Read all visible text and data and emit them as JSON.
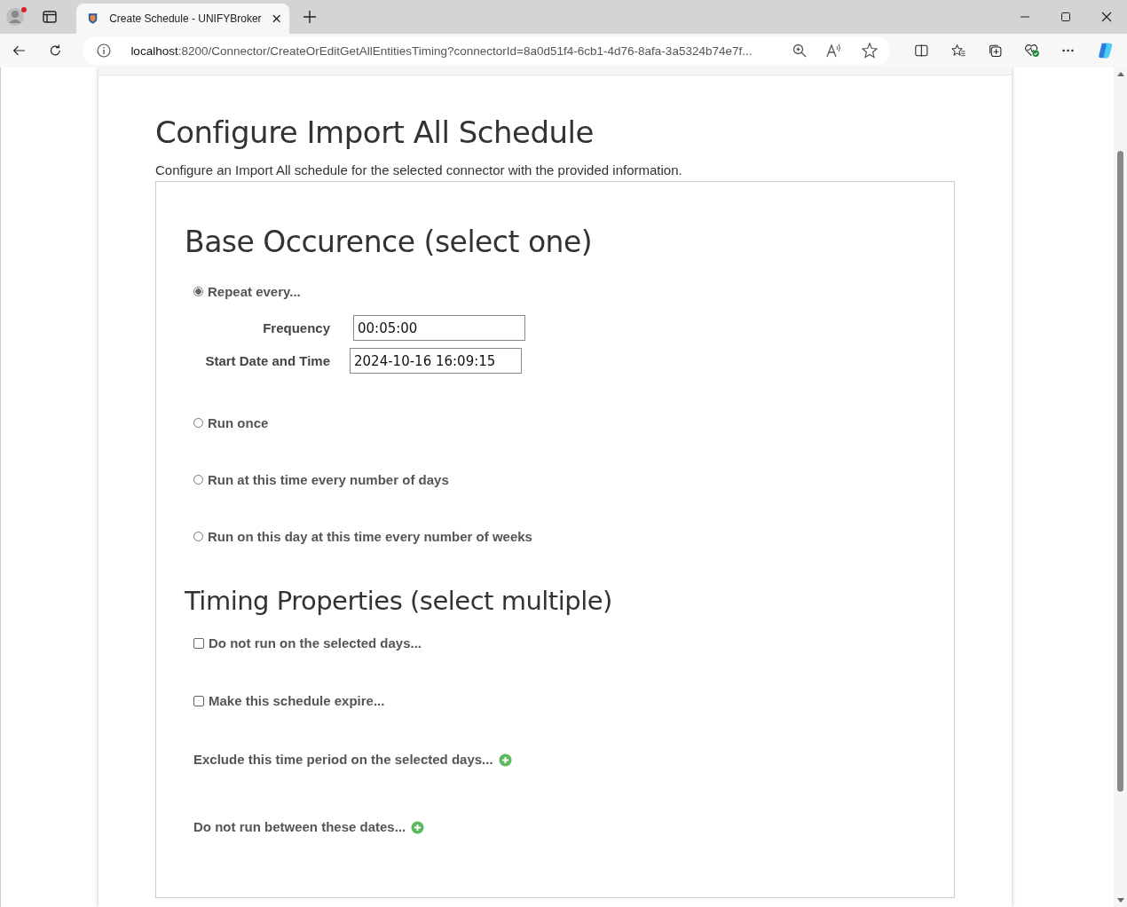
{
  "browser": {
    "tab_title": "Create Schedule - UNIFYBroker",
    "url_host": "localhost",
    "url_path": ":8200/Connector/CreateOrEditGetAllEntitiesTiming?connectorId=8a0d51f4-6cb1-4d76-8afa-3a5324b74e7f..."
  },
  "page": {
    "title": "Configure Import All Schedule",
    "subtitle": "Configure an Import All schedule for the selected connector with the provided information."
  },
  "base_occurrence": {
    "heading": "Base Occurence (select one)",
    "options": [
      {
        "label": "Repeat every...",
        "selected": true,
        "fields": [
          {
            "label": "Frequency",
            "value": "00:05:00"
          },
          {
            "label": "Start Date and Time",
            "value": "2024-10-16 16:09:15"
          }
        ]
      },
      {
        "label": "Run once",
        "selected": false
      },
      {
        "label": "Run at this time every number of days",
        "selected": false
      },
      {
        "label": "Run on this day at this time every number of weeks",
        "selected": false
      }
    ]
  },
  "timing_properties": {
    "heading": "Timing Properties (select multiple)",
    "items": [
      {
        "kind": "checkbox",
        "label": "Do not run on the selected days...",
        "checked": false
      },
      {
        "kind": "checkbox",
        "label": "Make this schedule expire...",
        "checked": false
      },
      {
        "kind": "add",
        "label": "Exclude this time period on the selected days..."
      },
      {
        "kind": "add",
        "label": "Do not run between these dates..."
      }
    ]
  }
}
